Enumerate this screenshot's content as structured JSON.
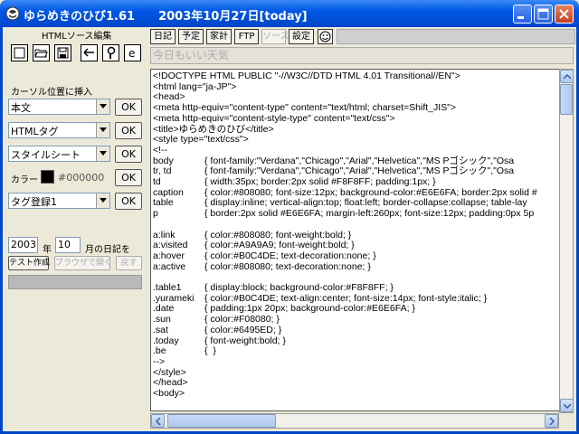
{
  "window": {
    "title": "ゆらめきのひび1.61　　2003年10月27日[today]"
  },
  "left_panel": {
    "section_title": "HTMLソース編集",
    "insert_label": "カーソル位置に挿入",
    "combos": [
      {
        "value": "本文",
        "ok": "OK"
      },
      {
        "value": "HTMLタグ",
        "ok": "OK"
      },
      {
        "value": "スタイルシート",
        "ok": "OK"
      }
    ],
    "color_label": "カラー",
    "color_value": "#000000",
    "color_ok": "OK",
    "tag_combo": {
      "value": "タグ登録1",
      "ok": "OK"
    },
    "year_value": "2003",
    "year_unit": "年",
    "month_value": "10",
    "month_suffix": "月の日記を",
    "test_button": "テスト作成",
    "browser_button": "ブラウザで開く",
    "back_button": "戻す"
  },
  "toolbar": {
    "buttons": [
      "日記",
      "予定",
      "家計",
      "FTP",
      "ソース",
      "設定"
    ],
    "status_text": "今日もいい天気"
  },
  "editor": {
    "lines": [
      "<!DOCTYPE HTML PUBLIC \"-//W3C//DTD HTML 4.01 Transitional//EN\">",
      "<html lang=\"ja-JP\">",
      "<head>",
      "<meta http-equiv=\"content-type\" content=\"text/html; charset=Shift_JIS\">",
      "<meta http-equiv=\"content-style-type\" content=\"text/css\">",
      "<title>ゆらめきのひび</title>",
      "<style type=\"text/css\">",
      "<!--"
    ],
    "css_rules": [
      {
        "sel": "body",
        "decl": "{ font-family:\"Verdana\",\"Chicago\",\"Arial\",\"Helvetica\",\"MS Pゴシック\",\"Osa"
      },
      {
        "sel": "tr, td",
        "decl": "{ font-family:\"Verdana\",\"Chicago\",\"Arial\",\"Helvetica\",\"MS Pゴシック\",\"Osa"
      },
      {
        "sel": "td",
        "decl": "{ width:35px; border:2px solid #F8F8FF; padding:1px; }"
      },
      {
        "sel": "caption",
        "decl": "{ color:#808080; font-size:12px; background-color:#E6E6FA; border:2px solid #"
      },
      {
        "sel": "table",
        "decl": "{ display:inline; vertical-align:top; float:left; border-collapse:collapse; table-lay"
      },
      {
        "sel": "p",
        "decl": "{ border:2px solid #E6E6FA; margin-left:260px; font-size:12px; padding:0px 5p"
      },
      {
        "sel": "",
        "decl": ""
      },
      {
        "sel": "a:link",
        "decl": "{ color:#808080; font-weight:bold; }"
      },
      {
        "sel": "a:visited",
        "decl": "{ color:#A9A9A9; font-weight:bold; }"
      },
      {
        "sel": "a:hover",
        "decl": "{ color:#B0C4DE; text-decoration:none; }"
      },
      {
        "sel": "a:active",
        "decl": "{ color:#808080; text-decoration:none; }"
      },
      {
        "sel": "",
        "decl": ""
      },
      {
        "sel": ".table1",
        "decl": "{ display:block; background-color:#F8F8FF; }"
      },
      {
        "sel": ".yurameki",
        "decl": "{ color:#B0C4DE; text-align:center; font-size:14px; font-style:italic; }"
      },
      {
        "sel": ".date",
        "decl": "{ padding:1px 20px; background-color:#E6E6FA; }"
      },
      {
        "sel": ".sun",
        "decl": "{ color:#F08080; }"
      },
      {
        "sel": ".sat",
        "decl": "{ color:#6495ED; }"
      },
      {
        "sel": ".today",
        "decl": "{ font-weight:bold; }"
      },
      {
        "sel": ".be",
        "decl": "{  }"
      }
    ],
    "tail_lines": [
      "-->",
      "</style>",
      "</head>",
      "<body>"
    ]
  }
}
